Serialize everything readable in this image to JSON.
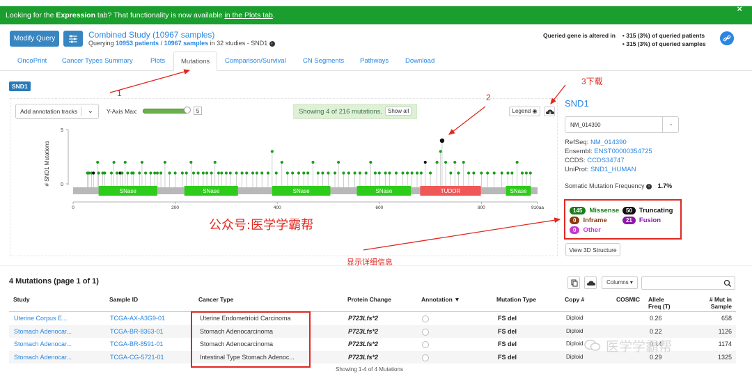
{
  "banner": {
    "text_pre": "Looking for the ",
    "text_bold": "Expression",
    "text_mid": " tab? That functionality is now available ",
    "text_link": "in the Plots tab",
    "text_end": ".",
    "close": "×"
  },
  "header": {
    "modify_query": "Modify Query",
    "study_title": "Combined Study (10967 samples)",
    "querying_pre": "Querying ",
    "patients": "10953 patients",
    "sep": " / ",
    "samples": "10967 samples",
    "querying_post": " in 32 studies  - SND1",
    "altered_label": "Queried gene is altered in",
    "altered_patients": "• 315 (3%) of queried patients",
    "altered_samples": "• 315 (3%) of queried samples"
  },
  "tabs": [
    "OncoPrint",
    "Cancer Types Summary",
    "Plots",
    "Mutations",
    "Comparison/Survival",
    "CN Segments",
    "Pathways",
    "Download"
  ],
  "active_tab": "Mutations",
  "gene_badge": "SND1",
  "controls": {
    "annotation_tracks": "Add annotation tracks",
    "ymax_label": "Y-Axis Max:",
    "ymax_value": "5",
    "showing": "Showing 4 of 216 mutations.",
    "show_all": "Show all",
    "legend": "Legend"
  },
  "lollipop_plot": {
    "ylabel": "# SND1 Mutations",
    "y_ticks": [
      "5",
      "0"
    ],
    "x_ticks": [
      "0",
      "200",
      "400",
      "600",
      "800",
      "910aa"
    ],
    "domains": [
      "SNase",
      "SNase",
      "SNase",
      "SNase",
      "TUDOR",
      "SNase"
    ],
    "domain_colors": {
      "SNase": "#2ecc1a",
      "TUDOR": "#f05858"
    }
  },
  "gene_panel": {
    "title": "SND1",
    "transcript": "NM_014390",
    "refseq_label": "RefSeq: ",
    "refseq": "NM_014390",
    "ensembl_label": "Ensembl: ",
    "ensembl": "ENST00000354725",
    "ccds_label": "CCDS: ",
    "ccds": "CCDS34747",
    "uniprot_label": "UniProt: ",
    "uniprot": "SND1_HUMAN",
    "smf_label": "Somatic Mutation Frequency",
    "smf_value": "1.7%",
    "view3d": "View 3D Structure"
  },
  "mutation_types": [
    {
      "count": "145",
      "label": "Missense",
      "color": "#1a7e1a",
      "text_color": "#1a7e1a"
    },
    {
      "count": "50",
      "label": "Truncating",
      "color": "#111111",
      "text_color": "#111111"
    },
    {
      "count": "0",
      "label": "Inframe",
      "color": "#8b3a10",
      "text_color": "#8b3a10"
    },
    {
      "count": "21",
      "label": "Fusion",
      "color": "#8b1aa8",
      "text_color": "#8b1aa8"
    },
    {
      "count": "0",
      "label": "Other",
      "color": "#c83ad0",
      "text_color": "#c83ad0"
    }
  ],
  "table": {
    "title": "4 Mutations (page 1 of 1)",
    "columns_btn": "Columns",
    "headers": {
      "study": "Study",
      "sample_id": "Sample ID",
      "cancer_type": "Cancer Type",
      "protein_change": "Protein Change",
      "annotation": "Annotation ▼",
      "mutation_type": "Mutation Type",
      "copy": "Copy #",
      "cosmic": "COSMIC",
      "allele_freq_1": "Allele",
      "allele_freq_2": "Freq (T)",
      "mut_in_sample_1": "# Mut in",
      "mut_in_sample_2": "Sample"
    },
    "rows": [
      {
        "study": "Uterine Corpus E...",
        "sample": "TCGA-AX-A3G9-01",
        "cancer": "Uterine Endometrioid Carcinoma",
        "protein": "P723Lfs*2",
        "mtype": "FS del",
        "copy": "Diploid",
        "af": "0.26",
        "mut": "658"
      },
      {
        "study": "Stomach Adenocar...",
        "sample": "TCGA-BR-8363-01",
        "cancer": "Stomach Adenocarcinoma",
        "protein": "P723Lfs*2",
        "mtype": "FS del",
        "copy": "Diploid",
        "af": "0.22",
        "mut": "1126"
      },
      {
        "study": "Stomach Adenocar...",
        "sample": "TCGA-BR-8591-01",
        "cancer": "Stomach Adenocarcinoma",
        "protein": "P723Lfs*2",
        "mtype": "FS del",
        "copy": "Diploid",
        "af": "0.14",
        "mut": "1174"
      },
      {
        "study": "Stomach Adenocar...",
        "sample": "TCGA-CG-5721-01",
        "cancer": "Intestinal Type Stomach Adenoc...",
        "protein": "P723Lfs*2",
        "mtype": "FS del",
        "copy": "Diploid",
        "af": "0.29",
        "mut": "1325"
      }
    ],
    "footer": "Showing 1-4 of 4 Mutations"
  },
  "annotations": {
    "label1": "1",
    "label2": "2",
    "label3": "3下载",
    "watermark": "公众号:医学学霸帮",
    "detail_label": "显示详细信息",
    "wechat": "医学学霸帮"
  }
}
